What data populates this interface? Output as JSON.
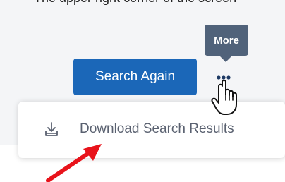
{
  "header": {
    "cut_text": "The upper right corner of the screen"
  },
  "toolbar": {
    "search_again_label": "Search Again",
    "more_icon": "more-dots-icon",
    "tooltip_text": "More"
  },
  "dropdown": {
    "items": [
      {
        "icon": "download-icon",
        "label": "Download Search Results"
      }
    ]
  },
  "annotations": {
    "cursor_icon": "hand-pointer-icon",
    "arrow_icon": "red-arrow-icon",
    "arrow_color": "#e8131b"
  },
  "colors": {
    "primary_button": "#1b67b8",
    "tooltip_bg": "#50627a",
    "menu_text": "#5a6170",
    "panel_bg": "#f4f5f7"
  }
}
